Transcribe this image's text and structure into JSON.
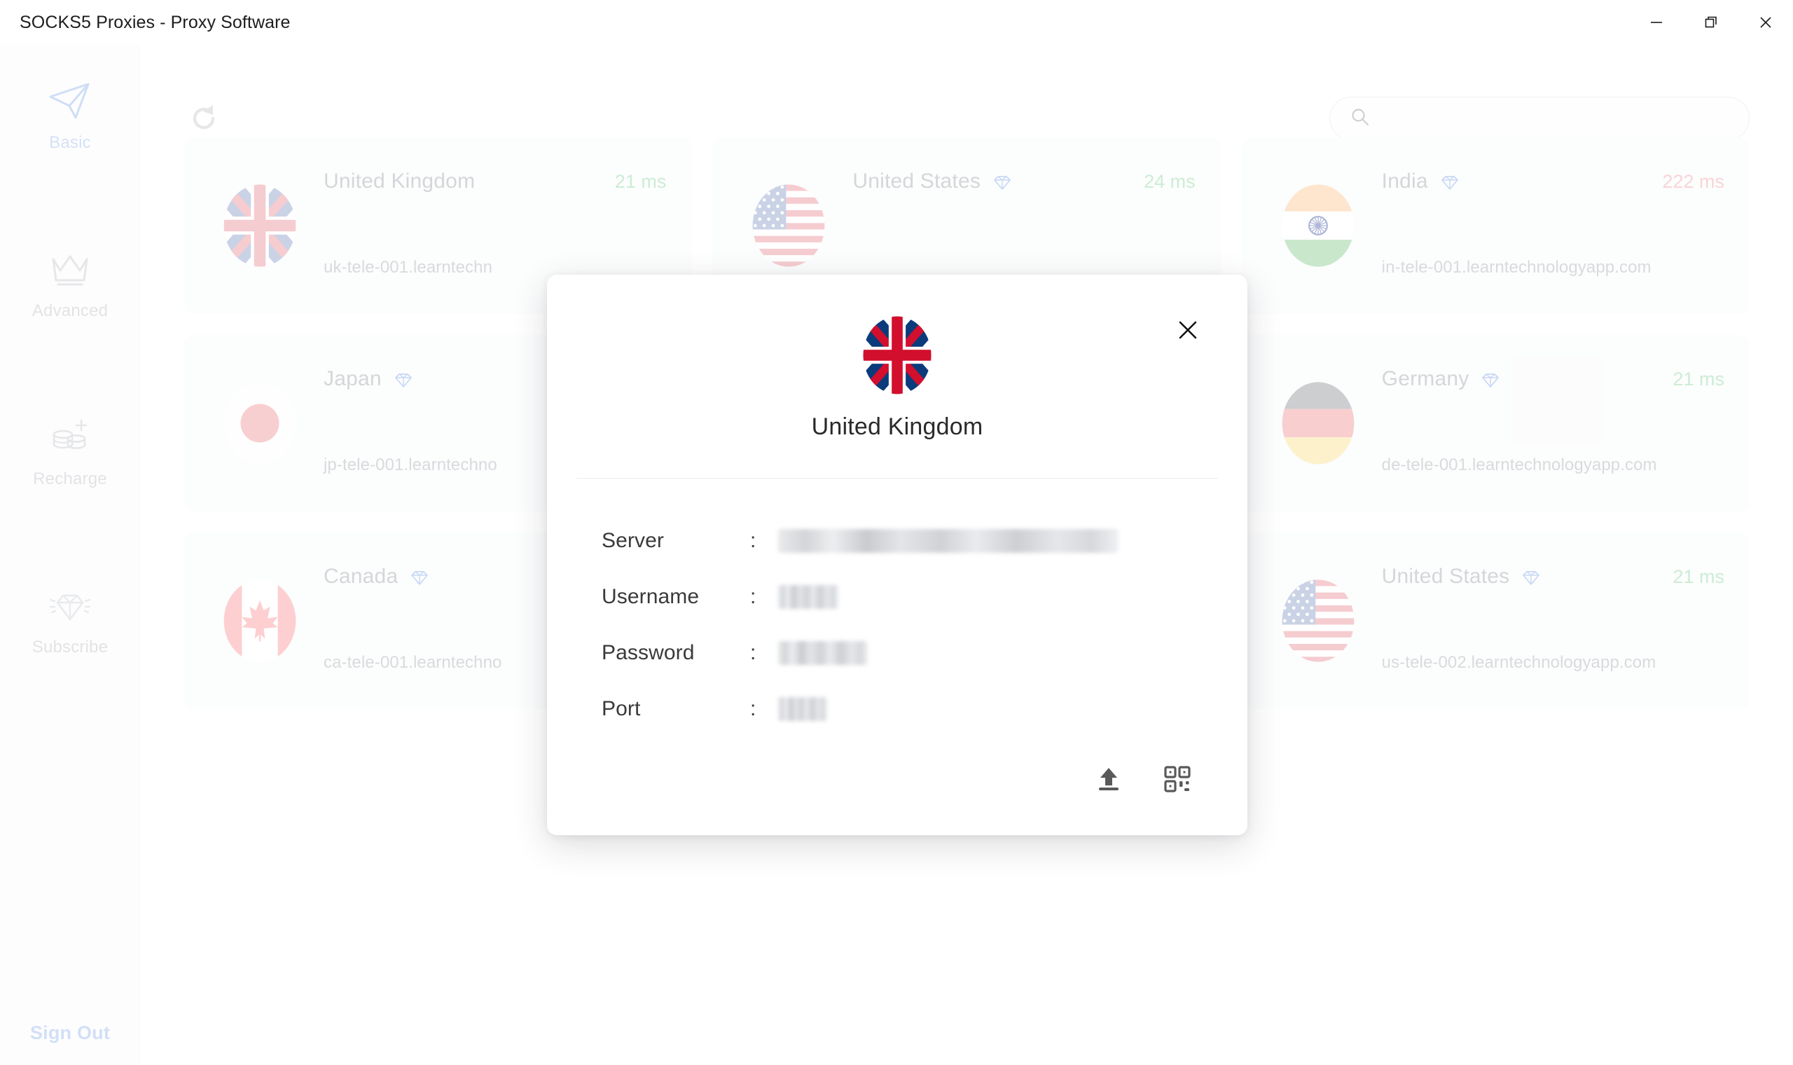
{
  "window": {
    "title": "SOCKS5 Proxies - Proxy Software",
    "controls": {
      "minimize": "minimize-button",
      "restore": "restore-button",
      "close": "close-button"
    }
  },
  "sidebar": {
    "items": [
      {
        "label": "Basic",
        "icon": "paper-plane-icon",
        "active": true
      },
      {
        "label": "Advanced",
        "icon": "crown-icon",
        "active": false
      },
      {
        "label": "Recharge",
        "icon": "coins-plus-icon",
        "active": false
      },
      {
        "label": "Subscribe",
        "icon": "diamond-icon",
        "active": false
      }
    ],
    "sign_out_label": "Sign Out"
  },
  "toolbar": {
    "refresh_icon": "refresh-icon",
    "search": {
      "icon": "search-icon",
      "value": "",
      "placeholder": ""
    }
  },
  "cards": [
    {
      "country": "United Kingdom",
      "flag": "uk",
      "premium": false,
      "ping": "21 ms",
      "ping_state": "good",
      "host": "uk-tele-001.learntechn"
    },
    {
      "country": "United States",
      "flag": "us",
      "premium": true,
      "ping": "24 ms",
      "ping_state": "good",
      "host": ""
    },
    {
      "country": "India",
      "flag": "in",
      "premium": true,
      "ping": "222 ms",
      "ping_state": "bad",
      "host": "in-tele-001.learntechnologyapp.com"
    },
    {
      "country": "Japan",
      "flag": "jp",
      "premium": true,
      "ping": "",
      "ping_state": "good",
      "host": "jp-tele-001.learntechno"
    },
    {
      "country": "",
      "flag": "none",
      "premium": false,
      "ping": "",
      "ping_state": "good",
      "host": ""
    },
    {
      "country": "Germany",
      "flag": "de",
      "premium": true,
      "ping": "21 ms",
      "ping_state": "good",
      "host": "de-tele-001.learntechnologyapp.com"
    },
    {
      "country": "Canada",
      "flag": "ca",
      "premium": true,
      "ping": "",
      "ping_state": "good",
      "host": "ca-tele-001.learntechno"
    },
    {
      "country": "",
      "flag": "none",
      "premium": false,
      "ping": "",
      "ping_state": "good",
      "host": ""
    },
    {
      "country": "United States",
      "flag": "us",
      "premium": true,
      "ping": "21 ms",
      "ping_state": "good",
      "host": "us-tele-002.learntechnologyapp.com"
    }
  ],
  "modal": {
    "flag": "uk",
    "title": "United Kingdom",
    "close_icon": "close-icon",
    "fields": [
      {
        "label": "Server",
        "separator": ":",
        "value": "",
        "redacted": true
      },
      {
        "label": "Username",
        "separator": ":",
        "value": "",
        "redacted": true
      },
      {
        "label": "Password",
        "separator": ":",
        "value": "",
        "redacted": true
      },
      {
        "label": "Port",
        "separator": ":",
        "value": "",
        "redacted": true
      }
    ],
    "actions": [
      {
        "icon": "upload-icon"
      },
      {
        "icon": "qr-code-icon"
      }
    ]
  },
  "colors": {
    "accent_blue": "#93b4ec",
    "gem_blue": "#7aa3e8",
    "ping_good": "#86d39a",
    "ping_bad": "#f09a9d",
    "card_bg": "#f8f9fa",
    "sidebar_bg": "#fafbfc"
  }
}
